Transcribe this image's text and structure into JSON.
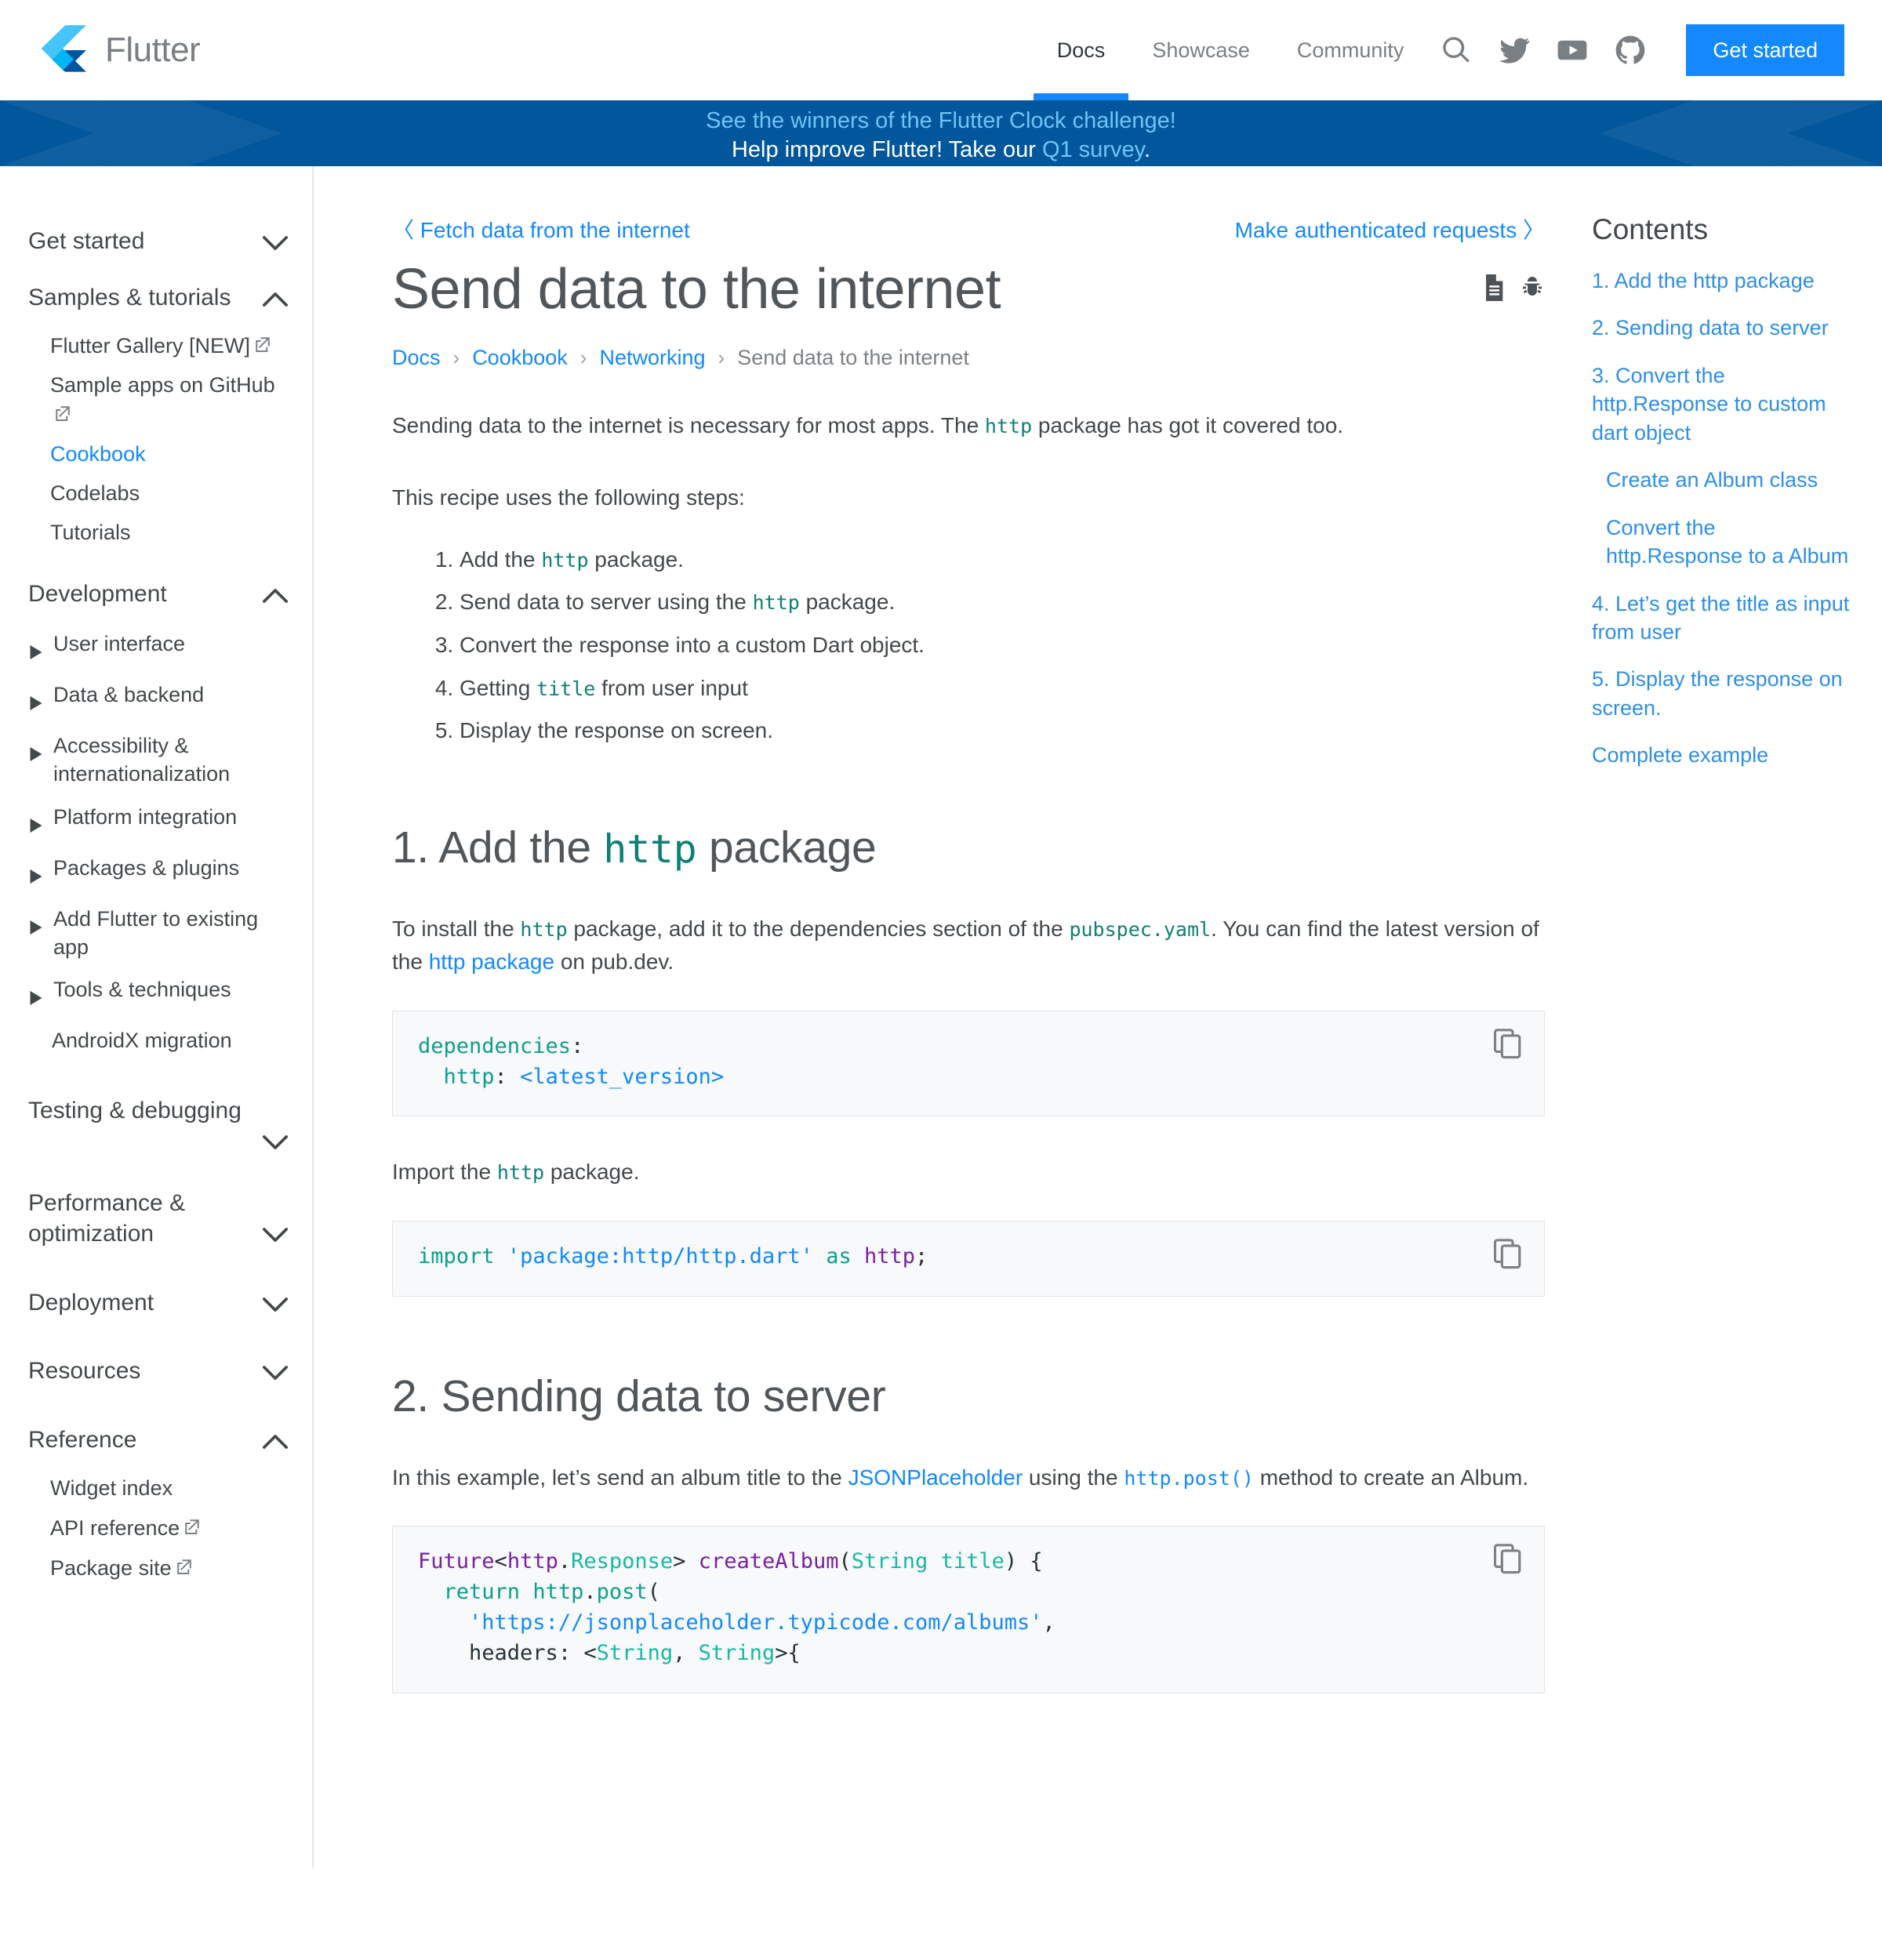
{
  "brand": {
    "name": "Flutter",
    "logo_icon": "flutter-logo-icon"
  },
  "topnav": {
    "links": [
      {
        "label": "Docs",
        "active": true
      },
      {
        "label": "Showcase",
        "active": false
      },
      {
        "label": "Community",
        "active": false
      }
    ],
    "icons": [
      {
        "name": "search-icon"
      },
      {
        "name": "twitter-icon"
      },
      {
        "name": "youtube-icon"
      },
      {
        "name": "github-icon"
      }
    ],
    "cta_label": "Get started",
    "accent_color": "#1389fd"
  },
  "banner": {
    "background_color": "#02569b",
    "line1_text": "See the winners of the Flutter Clock challenge!",
    "line2_prefix": "Help improve Flutter! Take our ",
    "line2_link": "Q1 survey",
    "line2_suffix": ".",
    "link_color": "#6fc4f7"
  },
  "sidebar": {
    "groups": [
      {
        "label": "Get started",
        "state": "collapsed",
        "chevron": "chevron-down-icon",
        "items": []
      },
      {
        "label": "Samples & tutorials",
        "state": "expanded",
        "chevron": "chevron-up-icon",
        "items": [
          {
            "label": "Flutter Gallery [NEW]",
            "external": true,
            "active": false
          },
          {
            "label": "Sample apps on GitHub",
            "external": true,
            "active": false
          },
          {
            "label": "Cookbook",
            "external": false,
            "active": true
          },
          {
            "label": "Codelabs",
            "external": false,
            "active": false
          },
          {
            "label": "Tutorials",
            "external": false,
            "active": false
          }
        ]
      },
      {
        "label": "Development",
        "state": "expanded",
        "chevron": "chevron-up-icon",
        "subs": [
          {
            "label": "User interface",
            "caret": true
          },
          {
            "label": "Data & backend",
            "caret": true
          },
          {
            "label": "Accessibility & internationalization",
            "caret": true
          },
          {
            "label": "Platform integration",
            "caret": true
          },
          {
            "label": "Packages & plugins",
            "caret": true
          },
          {
            "label": "Add Flutter to existing app",
            "caret": true
          },
          {
            "label": "Tools & techniques",
            "caret": true
          },
          {
            "label": "AndroidX migration",
            "caret": false
          }
        ]
      },
      {
        "label": "Testing & debugging",
        "state": "collapsed",
        "chevron": "chevron-down-icon"
      },
      {
        "label": "Performance & optimization",
        "state": "collapsed",
        "chevron": "chevron-down-icon"
      },
      {
        "label": "Deployment",
        "state": "collapsed",
        "chevron": "chevron-down-icon"
      },
      {
        "label": "Resources",
        "state": "collapsed",
        "chevron": "chevron-down-icon"
      },
      {
        "label": "Reference",
        "state": "expanded",
        "chevron": "chevron-up-icon",
        "items": [
          {
            "label": "Widget index",
            "external": false,
            "active": false
          },
          {
            "label": "API reference",
            "external": true,
            "active": false
          },
          {
            "label": "Package site",
            "external": true,
            "active": false
          }
        ]
      }
    ]
  },
  "main": {
    "prev_label": "Fetch data from the internet",
    "next_label": "Make authenticated requests",
    "prev_arrow": "〈",
    "next_arrow": "〉",
    "title": "Send data to the internet",
    "actions": [
      {
        "name": "view-source-icon"
      },
      {
        "name": "report-bug-icon"
      }
    ],
    "breadcrumb": [
      {
        "label": "Docs",
        "link": true
      },
      {
        "label": "Cookbook",
        "link": true
      },
      {
        "label": "Networking",
        "link": true
      },
      {
        "label": "Send data to the internet",
        "link": false
      }
    ],
    "breadcrumb_separator": "›",
    "intro_a": "Sending data to the internet is necessary for most apps. The ",
    "intro_code": "http",
    "intro_b": " package has got it covered too.",
    "steps_lead": "This recipe uses the following steps:",
    "steps": [
      {
        "a": "Add the ",
        "code": "http",
        "b": " package."
      },
      {
        "a": "Send data to server using the ",
        "code": "http",
        "b": " package."
      },
      {
        "a": "Convert the response into a custom Dart object.",
        "code": "",
        "b": ""
      },
      {
        "a": "Getting ",
        "code": "title",
        "b": " from user input"
      },
      {
        "a": "Display the response on screen.",
        "code": "",
        "b": ""
      }
    ],
    "section1": {
      "heading_a": "1. Add the ",
      "heading_code": "http",
      "heading_b": " package",
      "para_a": "To install the ",
      "para_code1": "http",
      "para_b": " package, add it to the dependencies section of the ",
      "para_code2": "pubspec.yaml",
      "para_c": ". You can find the latest version of the ",
      "para_link": "http package",
      "para_d": " on pub.dev.",
      "code1": "dependencies:\n  http: <latest_version>",
      "import_a": "Import the ",
      "import_code": "http",
      "import_b": " package.",
      "code2": "import 'package:http/http.dart' as http;"
    },
    "section2": {
      "heading": "2. Sending data to server",
      "para_a": "In this example, let’s send an album title to the ",
      "para_link1": "JSONPlaceholder",
      "para_b": " using the ",
      "para_code": "http.post()",
      "para_c": " method to create an Album.",
      "code3_lines": [
        "Future<http.Response> createAlbum(String title) {",
        "  return http.post(",
        "    'https://jsonplaceholder.typicode.com/albums',",
        "    headers: <String, String>{"
      ]
    },
    "copy_icon": "copy-icon"
  },
  "toc": {
    "title": "Contents",
    "items": [
      {
        "label": "1. Add the http package",
        "sub": false
      },
      {
        "label": "2. Sending data to server",
        "sub": false
      },
      {
        "label": "3. Convert the http.Response to custom dart object",
        "sub": false
      },
      {
        "label": "Create an Album class",
        "sub": true
      },
      {
        "label": "Convert the http.Response to a Album",
        "sub": true
      },
      {
        "label": "4. Let’s get the title as input from user",
        "sub": false
      },
      {
        "label": "5. Display the response on screen.",
        "sub": false
      },
      {
        "label": "Complete example",
        "sub": false
      }
    ]
  }
}
